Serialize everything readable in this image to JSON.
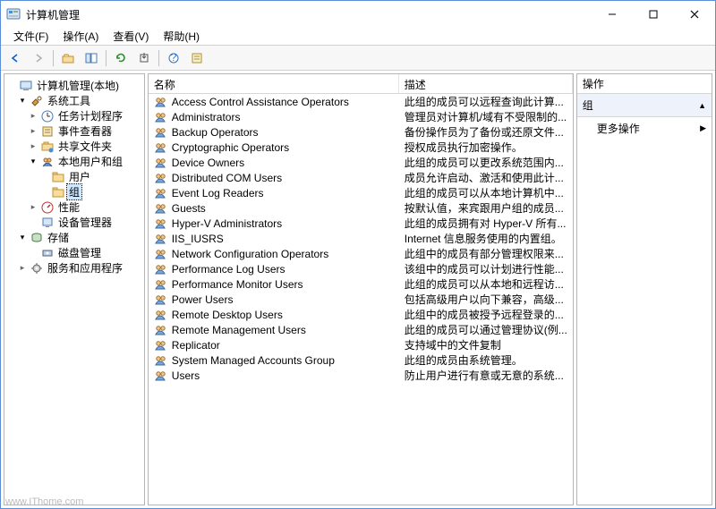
{
  "window": {
    "title": "计算机管理"
  },
  "menu": {
    "file": "文件(F)",
    "action": "操作(A)",
    "view": "查看(V)",
    "help": "帮助(H)"
  },
  "tree": {
    "root": "计算机管理(本地)",
    "tools": "系统工具",
    "task_scheduler": "任务计划程序",
    "event_viewer": "事件查看器",
    "shared": "共享文件夹",
    "local_users": "本地用户和组",
    "users": "用户",
    "groups": "组",
    "perf": "性能",
    "devmgr": "设备管理器",
    "storage": "存储",
    "diskmgr": "磁盘管理",
    "services": "服务和应用程序"
  },
  "list": {
    "col_name": "名称",
    "col_desc": "描述",
    "rows": [
      {
        "name": "Access Control Assistance Operators",
        "desc": "此组的成员可以远程查询此计算..."
      },
      {
        "name": "Administrators",
        "desc": "管理员对计算机/域有不受限制的..."
      },
      {
        "name": "Backup Operators",
        "desc": "备份操作员为了备份或还原文件..."
      },
      {
        "name": "Cryptographic Operators",
        "desc": "授权成员执行加密操作。"
      },
      {
        "name": "Device Owners",
        "desc": "此组的成员可以更改系统范围内..."
      },
      {
        "name": "Distributed COM Users",
        "desc": "成员允许启动、激活和使用此计..."
      },
      {
        "name": "Event Log Readers",
        "desc": "此组的成员可以从本地计算机中..."
      },
      {
        "name": "Guests",
        "desc": "按默认值，来宾跟用户组的成员..."
      },
      {
        "name": "Hyper-V Administrators",
        "desc": "此组的成员拥有对 Hyper-V 所有..."
      },
      {
        "name": "IIS_IUSRS",
        "desc": "Internet 信息服务使用的内置组。"
      },
      {
        "name": "Network Configuration Operators",
        "desc": "此组中的成员有部分管理权限来..."
      },
      {
        "name": "Performance Log Users",
        "desc": "该组中的成员可以计划进行性能..."
      },
      {
        "name": "Performance Monitor Users",
        "desc": "此组的成员可以从本地和远程访..."
      },
      {
        "name": "Power Users",
        "desc": "包括高级用户以向下兼容，高级..."
      },
      {
        "name": "Remote Desktop Users",
        "desc": "此组中的成员被授予远程登录的..."
      },
      {
        "name": "Remote Management Users",
        "desc": "此组的成员可以通过管理协议(例..."
      },
      {
        "name": "Replicator",
        "desc": "支持域中的文件复制"
      },
      {
        "name": "System Managed Accounts Group",
        "desc": "此组的成员由系统管理。"
      },
      {
        "name": "Users",
        "desc": "防止用户进行有意或无意的系统..."
      }
    ]
  },
  "actions": {
    "header": "操作",
    "section": "组",
    "more": "更多操作"
  },
  "watermark": "www.IThome.com"
}
